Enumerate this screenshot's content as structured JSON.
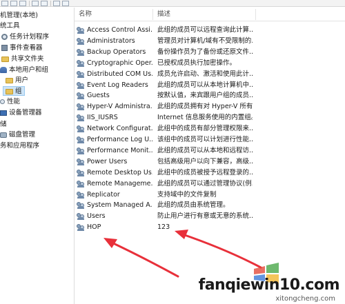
{
  "tree": {
    "items": [
      {
        "label": "机管理(本地)",
        "icon": "computer-icon"
      },
      {
        "label": "统工具",
        "icon": "tools-icon"
      },
      {
        "label": "任务计划程序",
        "icon": "clock-icon"
      },
      {
        "label": "事件查看器",
        "icon": "event-viewer-icon"
      },
      {
        "label": "共享文件夹",
        "icon": "folder-icon"
      },
      {
        "label": "本地用户和组",
        "icon": "users-icon"
      },
      {
        "label": "用户",
        "icon": "folder-icon"
      },
      {
        "label": "组",
        "icon": "folder-icon"
      },
      {
        "label": "性能",
        "icon": "performance-icon"
      },
      {
        "label": "设备管理器",
        "icon": "device-manager-icon"
      },
      {
        "label": "储",
        "icon": "storage-icon"
      },
      {
        "label": "磁盘管理",
        "icon": "disk-icon"
      },
      {
        "label": "务和应用程序",
        "icon": "services-icon"
      }
    ]
  },
  "list": {
    "columns": {
      "name": "名称",
      "description": "描述"
    },
    "rows": [
      {
        "name": "Access Control Assi...",
        "description": "此组的成员可以远程查询此计算..."
      },
      {
        "name": "Administrators",
        "description": "管理员对计算机/域有不受限制的..."
      },
      {
        "name": "Backup Operators",
        "description": "备份操作员为了备份或还原文件..."
      },
      {
        "name": "Cryptographic Oper...",
        "description": "已授权成员执行加密操作。"
      },
      {
        "name": "Distributed COM Us...",
        "description": "成员允许启动、激活和使用此计..."
      },
      {
        "name": "Event Log Readers",
        "description": "此组的成员可以从本地计算机中..."
      },
      {
        "name": "Guests",
        "description": "按默认值，来宾跟用户组的成员..."
      },
      {
        "name": "Hyper-V Administra...",
        "description": "此组的成员拥有对 Hyper-V 所有..."
      },
      {
        "name": "IIS_IUSRS",
        "description": "Internet 信息服务使用的内置组。"
      },
      {
        "name": "Network Configurat...",
        "description": "此组中的成员有部分管理权限来..."
      },
      {
        "name": "Performance Log U...",
        "description": "该组中的成员可以计划进行性能..."
      },
      {
        "name": "Performance Monit...",
        "description": "此组的成员可以从本地和远程访..."
      },
      {
        "name": "Power Users",
        "description": "包括高级用户以向下兼容，高级..."
      },
      {
        "name": "Remote Desktop Us...",
        "description": "此组中的成员被授予远程登录的..."
      },
      {
        "name": "Remote Manageme...",
        "description": "此组的成员可以通过管理协议(例..."
      },
      {
        "name": "Replicator",
        "description": "支持域中的文件复制"
      },
      {
        "name": "System Managed A...",
        "description": "此组的成员由系统管理。"
      },
      {
        "name": "Users",
        "description": "防止用户进行有意或无意的系统..."
      },
      {
        "name": "HOP",
        "description": "123"
      }
    ]
  },
  "watermark": {
    "text": "fanqiewin10.com",
    "sub": "xitongcheng.com"
  },
  "colors": {
    "arrow": "#e8303a",
    "selection": "#cde4f7"
  }
}
